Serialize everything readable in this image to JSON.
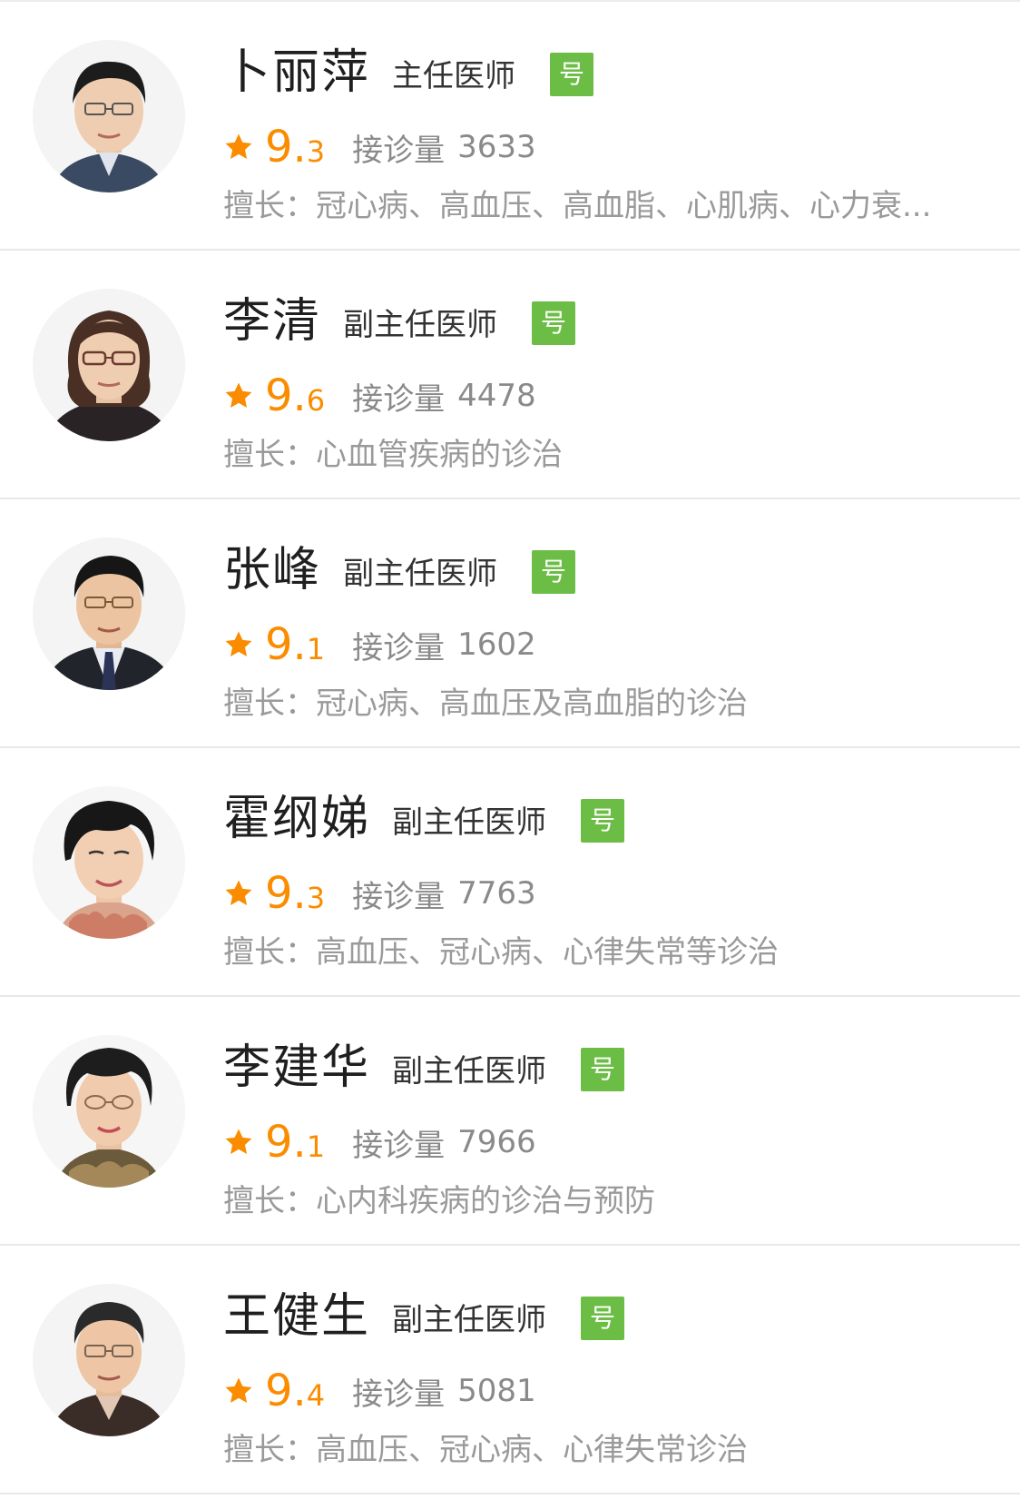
{
  "doctors": [
    {
      "name": "卜丽萍",
      "title": "主任医师",
      "badge": "号",
      "score_int": "9.",
      "score_dec": "3",
      "visits_label": "接诊量",
      "visits": "3633",
      "specialty_label": "擅长：",
      "specialty": "冠心病、高血压、高血脂、心肌病、心力衰..."
    },
    {
      "name": "李清",
      "title": "副主任医师",
      "badge": "号",
      "score_int": "9.",
      "score_dec": "6",
      "visits_label": "接诊量",
      "visits": "4478",
      "specialty_label": "擅长：",
      "specialty": "心血管疾病的诊治"
    },
    {
      "name": "张峰",
      "title": "副主任医师",
      "badge": "号",
      "score_int": "9.",
      "score_dec": "1",
      "visits_label": "接诊量",
      "visits": "1602",
      "specialty_label": "擅长：",
      "specialty": "冠心病、高血压及高血脂的诊治"
    },
    {
      "name": "霍纲娣",
      "title": "副主任医师",
      "badge": "号",
      "score_int": "9.",
      "score_dec": "3",
      "visits_label": "接诊量",
      "visits": "7763",
      "specialty_label": "擅长：",
      "specialty": "高血压、冠心病、心律失常等诊治"
    },
    {
      "name": "李建华",
      "title": "副主任医师",
      "badge": "号",
      "score_int": "9.",
      "score_dec": "1",
      "visits_label": "接诊量",
      "visits": "7966",
      "specialty_label": "擅长：",
      "specialty": "心内科疾病的诊治与预防"
    },
    {
      "name": "王健生",
      "title": "副主任医师",
      "badge": "号",
      "score_int": "9.",
      "score_dec": "4",
      "visits_label": "接诊量",
      "visits": "5081",
      "specialty_label": "擅长：",
      "specialty": "高血压、冠心病、心律失常诊治"
    }
  ],
  "colors": {
    "accent_orange": "#fb8c00",
    "badge_green": "#6cbd45",
    "muted_text": "#8a8a8a",
    "divider": "#e8e8e8"
  },
  "icons": {
    "rating": "star-icon",
    "avatar": "doctor-portrait"
  }
}
